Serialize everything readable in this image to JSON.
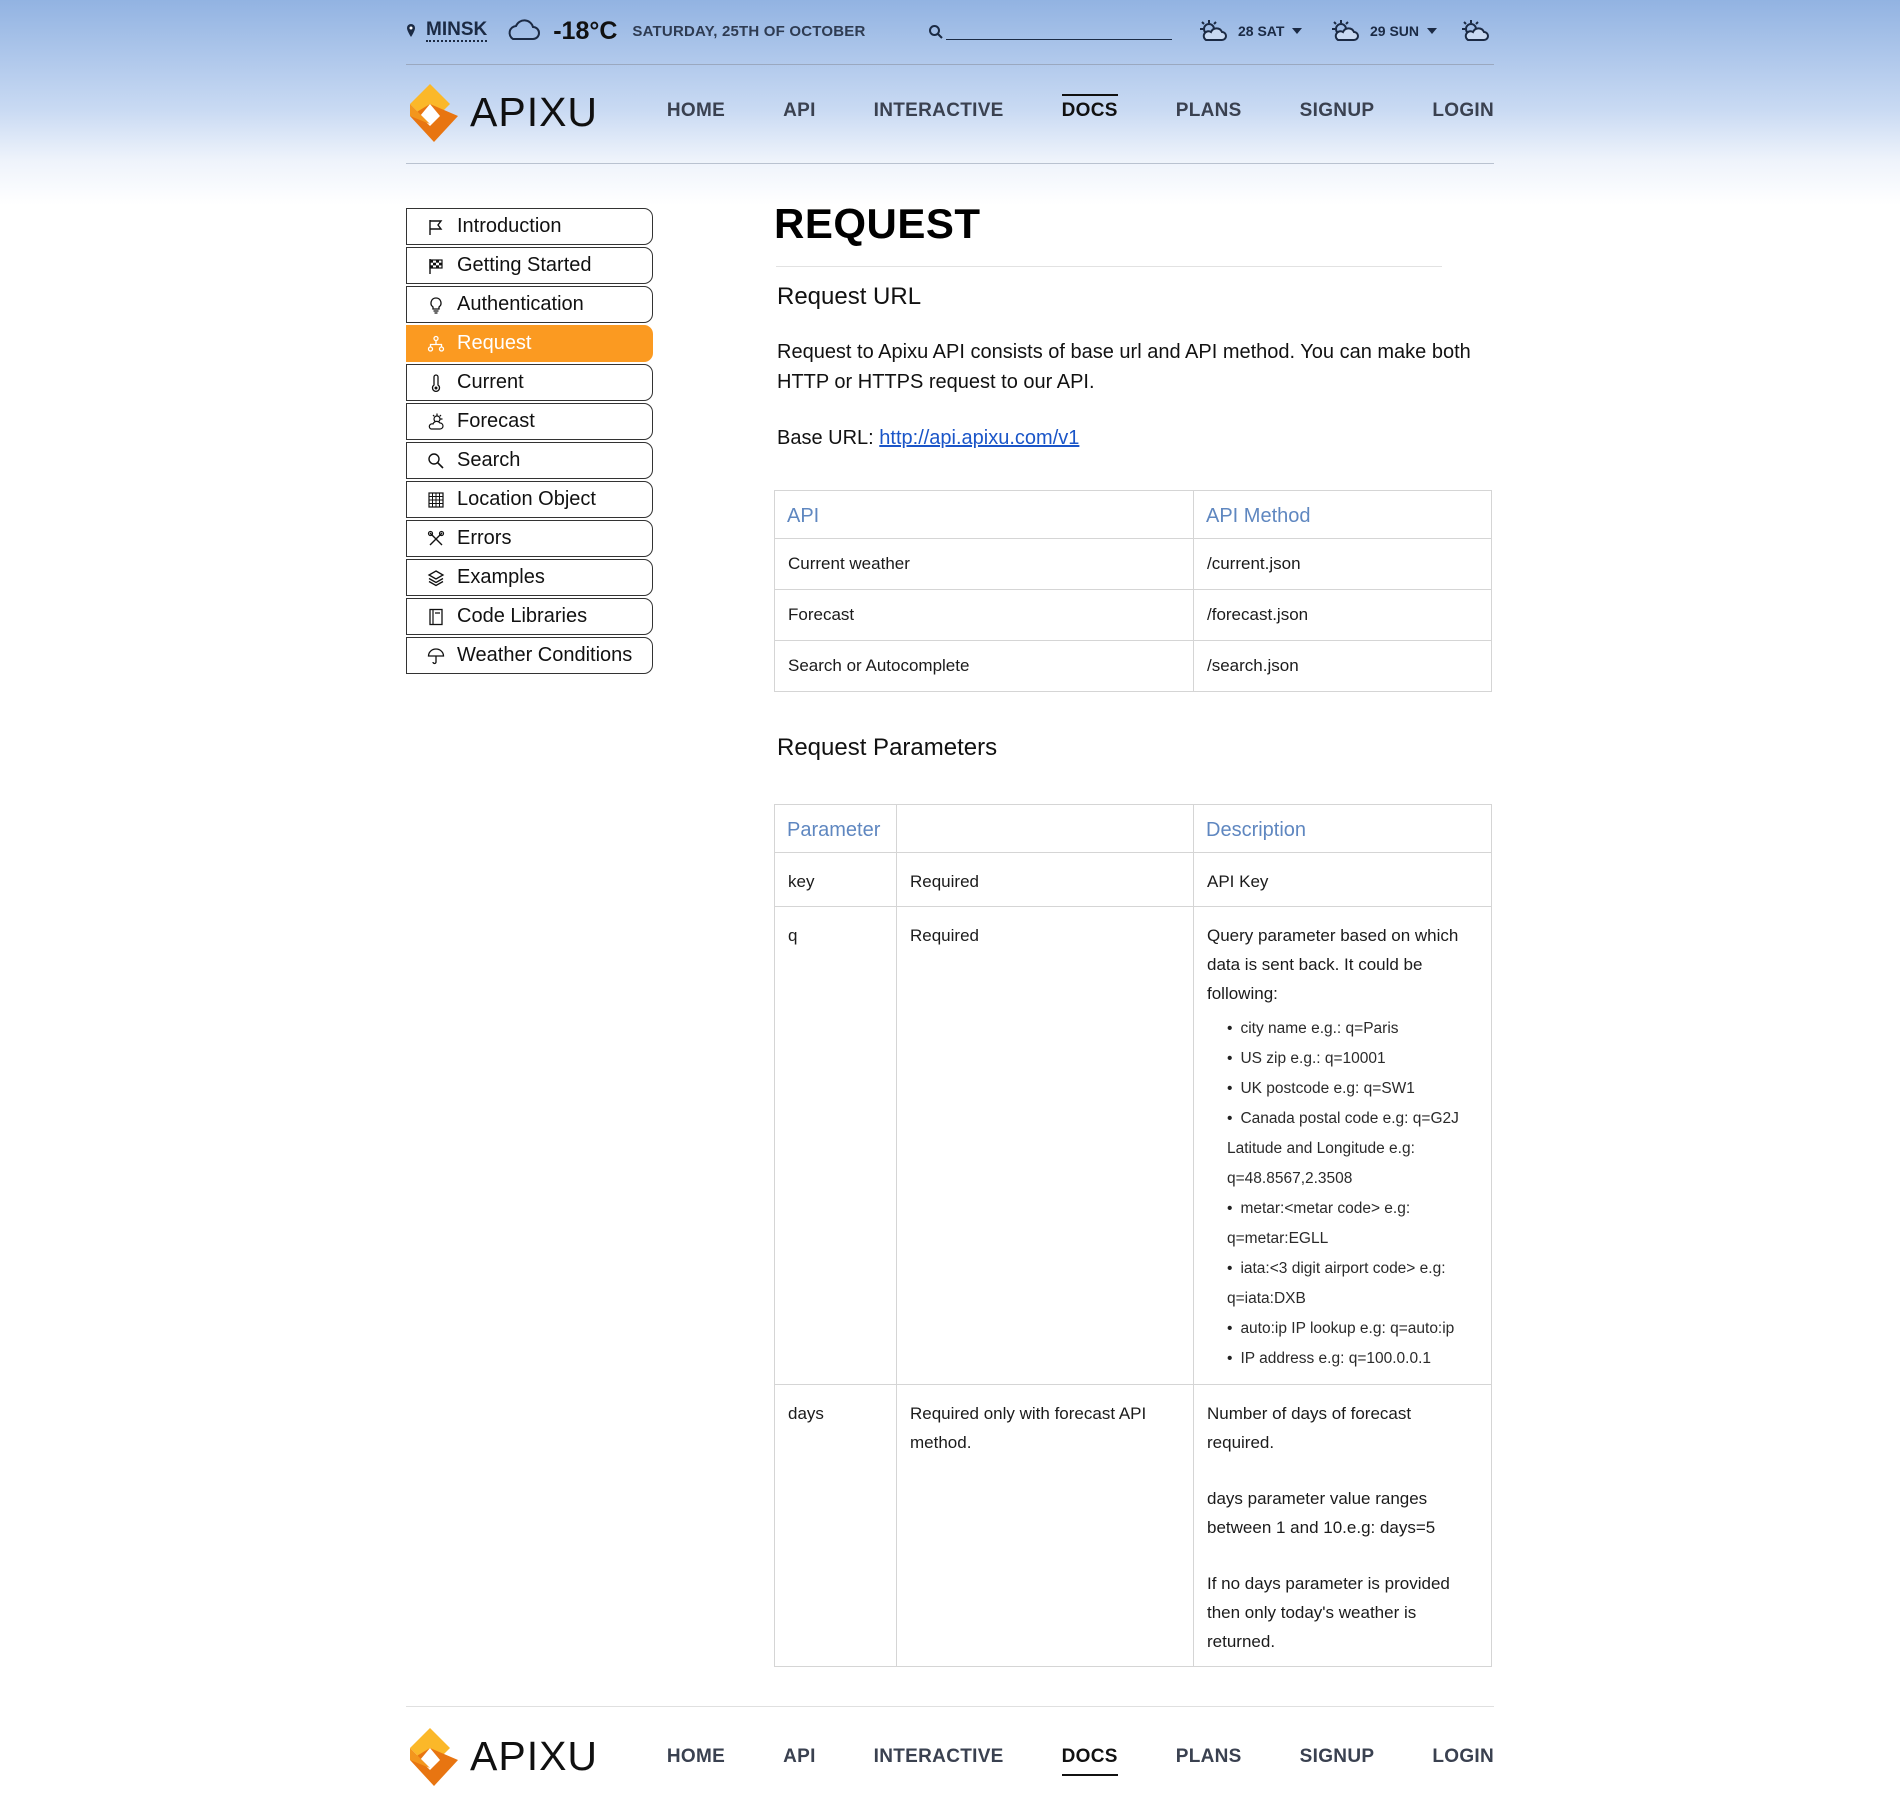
{
  "topbar": {
    "city": "MINSK",
    "temperature": "-18°C",
    "date": "SATURDAY, 25TH OF OCTOBER",
    "forecast": [
      {
        "label": "28 SAT"
      },
      {
        "label": "29 SUN"
      }
    ]
  },
  "brand": {
    "name": "APIXU",
    "accent": "#fb9a21"
  },
  "nav": [
    "HOME",
    "API",
    "INTERACTIVE",
    "DOCS",
    "PLANS",
    "SIGNUP",
    "LOGIN"
  ],
  "sidebar": {
    "items": [
      {
        "label": "Introduction",
        "icon": "flag-icon"
      },
      {
        "label": "Getting Started",
        "icon": "checkered-flag-icon"
      },
      {
        "label": "Authentication",
        "icon": "lightbulb-icon"
      },
      {
        "label": "Request",
        "icon": "sitemap-icon",
        "active": true
      },
      {
        "label": "Current",
        "icon": "thermometer-icon"
      },
      {
        "label": "Forecast",
        "icon": "sun-cloud-icon"
      },
      {
        "label": "Search",
        "icon": "search-icon"
      },
      {
        "label": "Location Object",
        "icon": "grid-icon"
      },
      {
        "label": "Errors",
        "icon": "tools-icon"
      },
      {
        "label": "Examples",
        "icon": "layers-icon"
      },
      {
        "label": "Code Libraries",
        "icon": "book-icon"
      },
      {
        "label": "Weather Conditions",
        "icon": "umbrella-icon"
      }
    ]
  },
  "main": {
    "title": "REQUEST",
    "request_url_heading": "Request URL",
    "intro": "Request to Apixu API consists of base url and API method. You can make both HTTP or HTTPS request to our API.",
    "base_url_label": "Base URL:",
    "base_url": "http://api.apixu.com/v1",
    "api_table": {
      "headers": [
        "API",
        "API Method"
      ],
      "rows": [
        [
          "Current weather",
          "/current.json"
        ],
        [
          "Forecast",
          "/forecast.json"
        ],
        [
          "Search or Autocomplete",
          "/search.json"
        ]
      ]
    },
    "params_heading": "Request Parameters",
    "params_table": {
      "headers": [
        "Parameter",
        "",
        "Description"
      ],
      "key": {
        "name": "key",
        "req": "Required",
        "desc": "API Key"
      },
      "q": {
        "name": "q",
        "req": "Required",
        "desc": "Query parameter based on which data is sent back. It could be following:",
        "list": [
          "city name e.g.: q=Paris",
          "US zip e.g.: q=10001",
          "UK postcode e.g: q=SW1",
          "Canada postal code e.g: q=G2J",
          "Latitude and Longitude e.g:",
          "q=48.8567,2.3508",
          "metar:<metar code> e.g:",
          "q=metar:EGLL",
          "iata:<3 digit airport code> e.g:",
          "q=iata:DXB",
          "auto:ip IP lookup e.g: q=auto:ip",
          "IP address e.g: q=100.0.0.1"
        ]
      },
      "days": {
        "name": "days",
        "req": "Required only with forecast API method.",
        "desc1": "Number of days of forecast required.",
        "desc2": "days parameter value ranges between 1 and 10.e.g: days=5",
        "desc3": "If no days parameter is provided then only today's weather is returned."
      }
    }
  }
}
